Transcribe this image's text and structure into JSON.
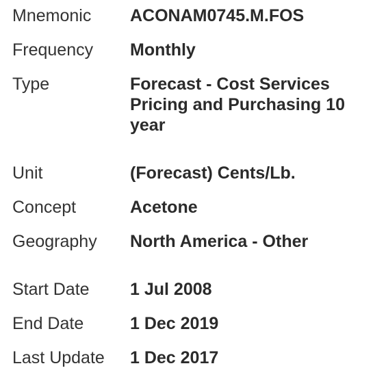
{
  "series_details": {
    "mnemonic": {
      "label": "Mnemonic",
      "value": "ACONAM0745.M.FOS"
    },
    "frequency": {
      "label": "Frequency",
      "value": "Monthly"
    },
    "type": {
      "label": "Type",
      "value": "Forecast - Cost Services Pricing and Purchasing 10 year"
    },
    "unit": {
      "label": "Unit",
      "value": "(Forecast) Cents/Lb."
    },
    "concept": {
      "label": "Concept",
      "value": "Acetone"
    },
    "geography": {
      "label": "Geography",
      "value": "North America - Other"
    },
    "start_date": {
      "label": "Start Date",
      "value": "1 Jul 2008"
    },
    "end_date": {
      "label": "End Date",
      "value": "1 Dec 2019"
    },
    "last_update": {
      "label": "Last Update",
      "value": "1 Dec 2017"
    }
  }
}
